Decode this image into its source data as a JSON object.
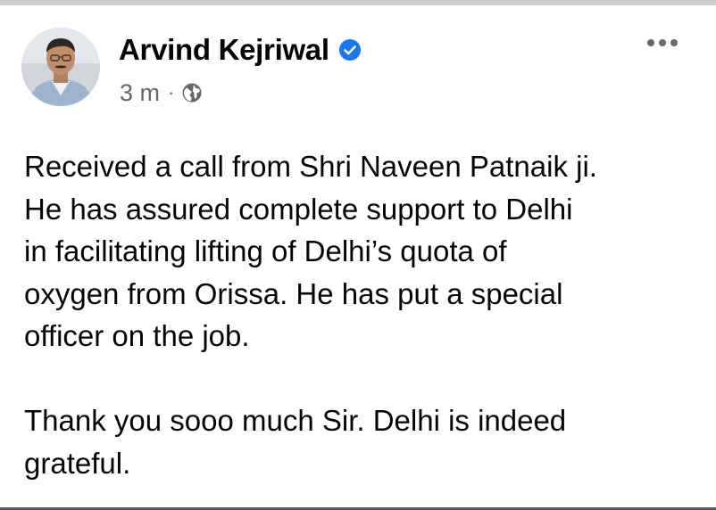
{
  "post": {
    "author": {
      "name": "Arvind Kejriwal",
      "verified": true,
      "avatar": "profile-photo"
    },
    "meta": {
      "timestamp": "3 m",
      "separator": "·",
      "audience_icon": "globe-icon"
    },
    "menu_icon": "more-options-icon",
    "body": {
      "paragraphs": [
        "Received a call from Shri Naveen Patnaik ji.\nHe has assured complete support to Delhi\nin facilitating lifting of Delhi’s quota of\noxygen from Orissa. He has put a special\nofficer on the job.",
        "Thank you sooo much Sir. Delhi is indeed\ngrateful."
      ]
    }
  },
  "colors": {
    "verified_badge": "#1877f2",
    "secondary_text": "#65676b",
    "primary_text": "#050505",
    "top_border": "#c9ccd1"
  }
}
